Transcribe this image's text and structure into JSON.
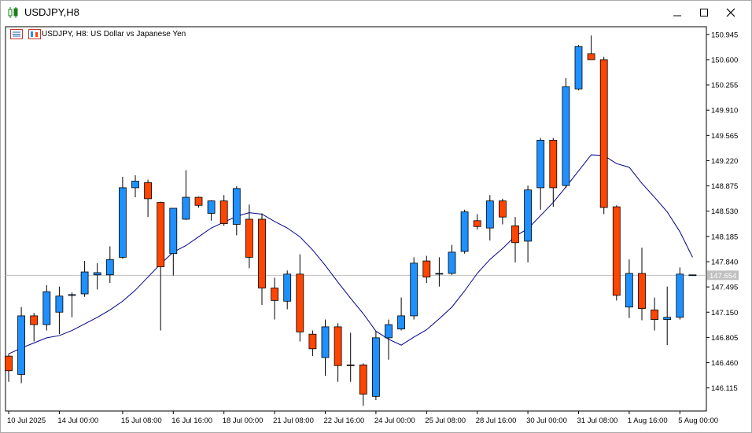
{
  "window": {
    "title": "USDJPY,H8",
    "chart_label": "USDJPY, H8:  US Dollar vs Japanese Yen"
  },
  "icons": {
    "title": "candlestick-chart-icon",
    "minimize": "minimize-icon",
    "maximize": "maximize-icon",
    "close": "close-icon"
  },
  "colors": {
    "bull": "#1e90ff",
    "bear": "#ff4500",
    "ma_line": "#00008b",
    "bid_line": "#c0c0c0",
    "price_tag_bg": "#c0c0c0"
  },
  "chart_data": {
    "type": "candlestick",
    "symbol": "USDJPY",
    "timeframe": "H8",
    "current_price": "147.654",
    "y_range": [
      145.8,
      151.05
    ],
    "y_ticks": [
      "150.945",
      "150.600",
      "150.255",
      "149.910",
      "149.565",
      "149.220",
      "148.875",
      "148.530",
      "148.185",
      "147.840",
      "147.495",
      "147.150",
      "146.805",
      "146.460",
      "146.115"
    ],
    "x_ticks": [
      {
        "index": 0,
        "label": "10 Jul 2025"
      },
      {
        "index": 4,
        "label": "14 Jul 00:00"
      },
      {
        "index": 9,
        "label": "15 Jul 08:00"
      },
      {
        "index": 13,
        "label": "16 Jul 16:00"
      },
      {
        "index": 17,
        "label": "18 Jul 00:00"
      },
      {
        "index": 21,
        "label": "21 Jul 08:00"
      },
      {
        "index": 25,
        "label": "22 Jul 16:00"
      },
      {
        "index": 29,
        "label": "24 Jul 00:00"
      },
      {
        "index": 33,
        "label": "25 Jul 08:00"
      },
      {
        "index": 37,
        "label": "28 Jul 16:00"
      },
      {
        "index": 41,
        "label": "30 Jul 00:00"
      },
      {
        "index": 45,
        "label": "31 Jul 08:00"
      },
      {
        "index": 49,
        "label": "1 Aug 16:00"
      },
      {
        "index": 53,
        "label": "5 Aug 00:00"
      }
    ],
    "candles": [
      [
        146.55,
        146.58,
        146.2,
        146.35
      ],
      [
        146.3,
        147.22,
        146.18,
        147.1
      ],
      [
        147.1,
        147.14,
        146.75,
        146.98
      ],
      [
        146.98,
        147.52,
        146.9,
        147.43
      ],
      [
        147.15,
        147.5,
        146.85,
        147.37
      ],
      [
        147.38,
        147.42,
        147.08,
        147.39
      ],
      [
        147.4,
        147.85,
        147.36,
        147.7
      ],
      [
        147.66,
        147.82,
        147.46,
        147.69
      ],
      [
        147.66,
        148.05,
        147.55,
        147.87
      ],
      [
        147.9,
        149.0,
        147.88,
        148.85
      ],
      [
        148.85,
        149.02,
        148.72,
        148.94
      ],
      [
        148.92,
        148.96,
        148.45,
        148.7
      ],
      [
        148.65,
        148.66,
        146.9,
        147.77
      ],
      [
        147.95,
        148.55,
        147.65,
        148.57
      ],
      [
        148.42,
        149.09,
        148.41,
        148.72
      ],
      [
        148.72,
        148.73,
        148.58,
        148.61
      ],
      [
        148.5,
        148.68,
        148.4,
        148.67
      ],
      [
        148.67,
        148.75,
        148.33,
        148.36
      ],
      [
        148.35,
        148.87,
        148.2,
        148.84
      ],
      [
        148.42,
        148.62,
        147.75,
        147.9
      ],
      [
        148.42,
        148.5,
        147.25,
        147.48
      ],
      [
        147.48,
        147.62,
        147.05,
        147.31
      ],
      [
        147.3,
        147.72,
        147.19,
        147.67
      ],
      [
        147.67,
        147.94,
        146.75,
        146.88
      ],
      [
        146.85,
        146.9,
        146.55,
        146.65
      ],
      [
        146.53,
        147.05,
        146.28,
        146.95
      ],
      [
        146.95,
        147.0,
        146.2,
        146.42
      ],
      [
        146.43,
        146.87,
        146.2,
        146.42
      ],
      [
        146.43,
        146.45,
        145.87,
        146.03
      ],
      [
        146.0,
        146.89,
        145.95,
        146.8
      ],
      [
        146.8,
        147.05,
        146.5,
        146.98
      ],
      [
        146.92,
        147.35,
        146.9,
        147.1
      ],
      [
        147.1,
        147.9,
        147.05,
        147.82
      ],
      [
        147.85,
        147.92,
        147.55,
        147.63
      ],
      [
        147.68,
        147.9,
        147.5,
        147.68
      ],
      [
        147.68,
        148.07,
        147.66,
        147.97
      ],
      [
        147.98,
        148.55,
        147.95,
        148.52
      ],
      [
        148.4,
        148.49,
        148.28,
        148.32
      ],
      [
        148.3,
        148.75,
        148.13,
        148.67
      ],
      [
        148.67,
        148.7,
        148.35,
        148.45
      ],
      [
        148.33,
        148.45,
        147.83,
        148.1
      ],
      [
        148.12,
        148.88,
        147.83,
        148.82
      ],
      [
        148.85,
        149.53,
        148.55,
        149.5
      ],
      [
        149.5,
        149.53,
        148.59,
        148.85
      ],
      [
        148.88,
        150.35,
        148.85,
        150.23
      ],
      [
        150.2,
        150.8,
        150.18,
        150.78
      ],
      [
        150.68,
        150.93,
        150.6,
        150.6
      ],
      [
        150.6,
        150.64,
        148.49,
        148.58
      ],
      [
        148.59,
        148.61,
        147.31,
        147.38
      ],
      [
        147.22,
        147.87,
        147.07,
        147.68
      ],
      [
        147.68,
        148.03,
        147.04,
        147.2
      ],
      [
        147.18,
        147.35,
        146.9,
        147.05
      ],
      [
        147.05,
        147.5,
        146.7,
        147.08
      ],
      [
        147.08,
        147.76,
        147.05,
        147.67
      ],
      [
        147.66,
        147.66,
        147.65,
        147.66
      ]
    ],
    "moving_average": [
      146.58,
      146.66,
      146.73,
      146.8,
      146.83,
      146.9,
      146.99,
      147.08,
      147.18,
      147.3,
      147.45,
      147.63,
      147.81,
      147.97,
      148.06,
      148.18,
      148.3,
      148.38,
      148.46,
      148.51,
      148.49,
      148.39,
      148.3,
      148.18,
      148.0,
      147.79,
      147.56,
      147.34,
      147.13,
      146.89,
      146.78,
      146.7,
      146.81,
      146.91,
      147.06,
      147.22,
      147.44,
      147.68,
      147.87,
      148.02,
      148.19,
      148.29,
      148.47,
      148.65,
      148.86,
      149.08,
      149.3,
      149.29,
      149.18,
      149.13,
      148.91,
      148.72,
      148.52,
      148.25,
      147.9
    ]
  }
}
